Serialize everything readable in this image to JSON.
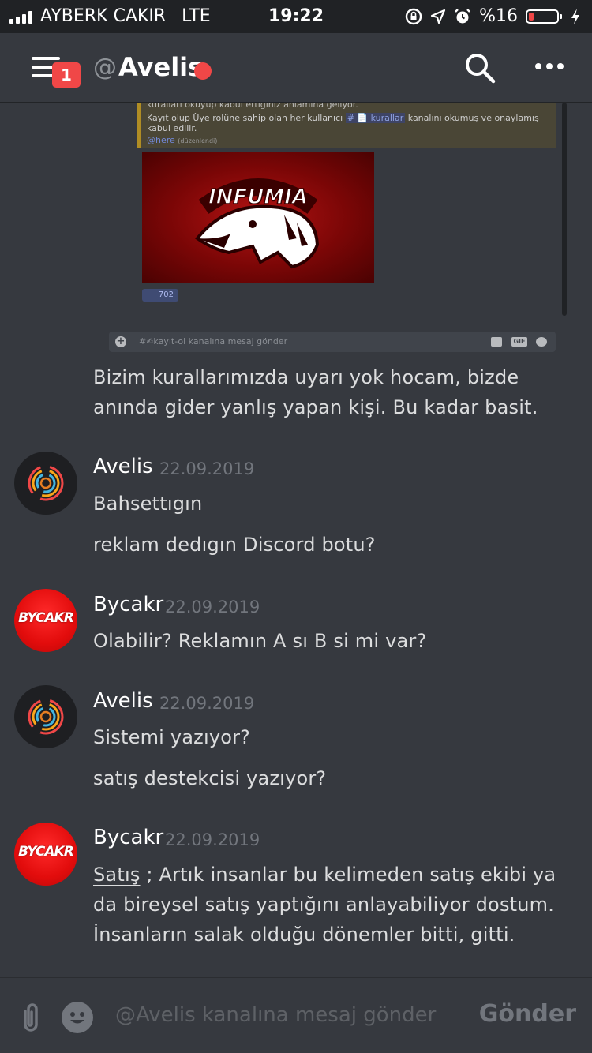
{
  "status_bar": {
    "carrier": "AYBERK CAKIR",
    "network": "LTE",
    "time": "19:22",
    "battery": "%16",
    "battery_level": 0.16,
    "icons": [
      "signal-bars-icon",
      "rotation-lock-icon",
      "location-arrow-icon",
      "alarm-icon",
      "battery-icon",
      "charging-bolt-icon"
    ]
  },
  "header": {
    "menu_badge": "1",
    "at_symbol": "@",
    "channel_name": "Avelis",
    "status_color": "#f04747",
    "icons": [
      "hamburger-menu-icon",
      "search-icon",
      "more-options-icon"
    ]
  },
  "embedded_screenshot": {
    "rules_line_1": "kuralları okuyup kabul ettiğiniz anlamına geliyor.",
    "rules_line_2_pre": "Kayıt olup Üye rolüne sahip olan her kullanıcı",
    "rules_channel": "# 📄 kurallar",
    "rules_line_2_post": "kanalını okumuş ve onaylamış kabul edilir.",
    "mention": "@here",
    "mention_sub": "(düzenlendi)",
    "logo_text": "INFUMIA",
    "reaction_count": "702",
    "input_placeholder": "#✍kayıt-ol kanalına mesaj gönder",
    "input_plus": "+",
    "gif_label": "GIF"
  },
  "messages": [
    {
      "type": "continuation",
      "text": "Bizim kurallarımızda uyarı yok hocam, bizde anında gider yanlış yapan kişi. Bu kadar basit."
    },
    {
      "author": "Avelis",
      "timestamp": "22.09.2019",
      "lines": [
        "Bahsettıgın",
        "reklam dedıgın Discord botu?"
      ]
    },
    {
      "author": "Bycakr",
      "timestamp": "22.09.2019",
      "avatar_text": "BYCAKR",
      "lines": [
        "Olabilir? Reklamın A sı B si mi var?"
      ]
    },
    {
      "author": "Avelis",
      "timestamp": "22.09.2019",
      "lines": [
        "Sistemi yazıyor?",
        "satış destekcisi yazıyor?"
      ]
    },
    {
      "author": "Bycakr",
      "timestamp": "22.09.2019",
      "avatar_text": "BYCAKR",
      "underlined_word": "Satış",
      "text_rest": " ; Artık insanlar bu kelimeden satış ekibi ya da bireysel satış yaptığını anlayabiliyor dostum. İnsanların salak olduğu dönemler bitti, gitti."
    }
  ],
  "input": {
    "placeholder": "@Avelis kanalına mesaj gönder",
    "send_label": "Gönder",
    "icons": [
      "paperclip-icon",
      "emoji-icon"
    ]
  }
}
